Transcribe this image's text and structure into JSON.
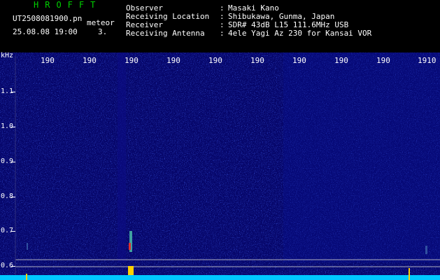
{
  "header": {
    "app_title": "HROFFT",
    "filename": "UT2508081900.pn",
    "camera": "meteor",
    "datetime": "25.08.08 19:00",
    "count": "3."
  },
  "info": [
    {
      "label": "Observer",
      "value": "Masaki Kano"
    },
    {
      "label": "Receiving Location",
      "value": "Shibukawa, Gunma, Japan"
    },
    {
      "label": "Receiver",
      "value": "SDR# 43dB L15 111.6MHz USB"
    },
    {
      "label": "Receiving Antenna",
      "value": "4ele Yagi Az 230 for Kansai VOR"
    }
  ],
  "axis": {
    "unit": "kHz",
    "y_ticks": [
      "1.1",
      "1.0",
      "0.9",
      "0.8",
      "0.7",
      "0.6"
    ],
    "x_ticks": [
      "190",
      "190",
      "190",
      "190",
      "190",
      "190",
      "190",
      "190",
      "190",
      "1910"
    ]
  },
  "colors": {
    "background": "#000000",
    "spectrogram": "#06066a",
    "title": "#00d000",
    "echo": "#ffd000",
    "baseline": "#00c8ff"
  }
}
